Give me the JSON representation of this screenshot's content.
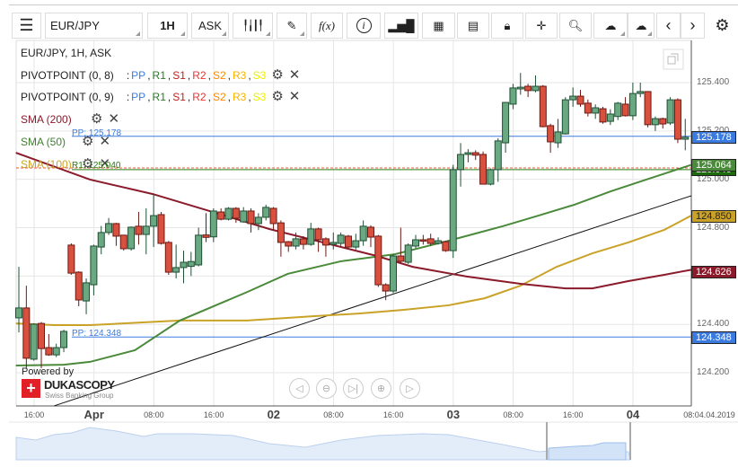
{
  "toolbar": {
    "symbol": "EUR/JPY",
    "timeframe": "1H",
    "side": "ASK",
    "fx_label": "f(x)"
  },
  "legend": {
    "title": "EUR/JPY, 1H, ASK",
    "pivot1": "PIVOTPOINT (0, 8)",
    "pivot2": "PIVOTPOINT (0, 9)",
    "sep": ":",
    "pivot_keys": [
      "PP",
      "R1",
      "S1",
      "R2",
      "S2",
      "R3",
      "S3"
    ],
    "sma200": "SMA (200)",
    "sma50": "SMA (50)",
    "sma100": "SMA (100)"
  },
  "line_labels": {
    "pp_top": "PP: 125.178",
    "r1": "R1: 125.040",
    "pp_bottom": "PP: 124.348"
  },
  "price_tags": {
    "pp_top": "125.178",
    "sma50": "125.064",
    "r1": "125.040",
    "sma100": "124.850",
    "sma200": "124.626",
    "pp_bottom": "124.348"
  },
  "colors": {
    "up": "#6aa882",
    "down": "#d9503f",
    "up_border": "#1f4f33",
    "down_border": "#6b1a14",
    "sma200": "#8b1a2b",
    "sma50": "#4a8a3a",
    "sma100": "#c9a227",
    "pp": "#3b7be0",
    "r1": "#2a7a10",
    "s_dashed": "#e53"
  },
  "branding": {
    "powered": "Powered by",
    "name": "DUKASCOPY",
    "sub": "Swiss Banking Group"
  },
  "chart_data": {
    "type": "candlestick",
    "ylim": [
      124.17,
      125.55
    ],
    "yticks": [
      "125.400",
      "125.200",
      "125.000",
      "124.800",
      "124.600",
      "124.400",
      "124.200"
    ],
    "xticks": [
      "16:00",
      "Apr",
      "08:00",
      "16:00",
      "02",
      "08:00",
      "16:00",
      "03",
      "08:00",
      "16:00",
      "04",
      "08:04.04.2019"
    ],
    "xticks_major": [
      1,
      4,
      7,
      10
    ],
    "candles_ohlc": [
      [
        124.427,
        124.638,
        124.367,
        124.468
      ],
      [
        124.468,
        124.56,
        124.219,
        124.26
      ],
      [
        124.256,
        124.405,
        124.25,
        124.401
      ],
      [
        124.404,
        124.41,
        124.219,
        124.3
      ],
      [
        124.304,
        124.36,
        124.27,
        124.274
      ],
      [
        124.274,
        124.32,
        124.265,
        124.304
      ],
      [
        124.304,
        124.378,
        124.285,
        124.371
      ],
      [
        124.728,
        124.735,
        124.605,
        124.612
      ],
      [
        124.616,
        124.62,
        124.475,
        124.501
      ],
      [
        124.497,
        124.59,
        124.442,
        124.572
      ],
      [
        124.564,
        124.73,
        124.52,
        124.724
      ],
      [
        124.72,
        124.807,
        124.69,
        124.78
      ],
      [
        124.78,
        124.84,
        124.77,
        124.817
      ],
      [
        124.817,
        124.82,
        124.725,
        124.765
      ],
      [
        124.769,
        124.77,
        124.705,
        124.713
      ],
      [
        124.713,
        124.805,
        124.705,
        124.802
      ],
      [
        124.806,
        124.865,
        124.73,
        124.772
      ],
      [
        124.772,
        124.88,
        124.69,
        124.806
      ],
      [
        124.806,
        124.94,
        124.72,
        124.85
      ],
      [
        124.854,
        124.865,
        124.73,
        124.735
      ],
      [
        124.739,
        124.745,
        124.605,
        124.616
      ],
      [
        124.616,
        124.73,
        124.59,
        124.635
      ],
      [
        124.635,
        124.705,
        124.57,
        124.657
      ],
      [
        124.64,
        124.7,
        124.6,
        124.66
      ],
      [
        124.646,
        124.8,
        124.64,
        124.769
      ],
      [
        124.77,
        124.86,
        124.74,
        124.76
      ],
      [
        124.762,
        124.88,
        124.74,
        124.869
      ],
      [
        124.865,
        124.88,
        124.83,
        124.835
      ],
      [
        124.835,
        124.885,
        124.83,
        124.88
      ],
      [
        124.88,
        124.885,
        124.82,
        124.839
      ],
      [
        124.824,
        124.885,
        124.82,
        124.869
      ],
      [
        124.869,
        124.88,
        124.78,
        124.817
      ],
      [
        124.817,
        124.86,
        124.79,
        124.843
      ],
      [
        124.843,
        124.895,
        124.83,
        124.884
      ],
      [
        124.88,
        124.885,
        124.79,
        124.817
      ],
      [
        124.82,
        124.83,
        124.68,
        124.739
      ],
      [
        124.742,
        124.745,
        124.7,
        124.724
      ],
      [
        124.724,
        124.78,
        124.71,
        124.754
      ],
      [
        124.754,
        124.765,
        124.71,
        124.731
      ],
      [
        124.731,
        124.82,
        124.725,
        124.795
      ],
      [
        124.795,
        124.8,
        124.7,
        124.75
      ],
      [
        124.754,
        124.76,
        124.68,
        124.728
      ],
      [
        124.731,
        124.78,
        124.71,
        124.739
      ],
      [
        124.735,
        124.78,
        124.72,
        124.769
      ],
      [
        124.765,
        124.77,
        124.715,
        124.72
      ],
      [
        124.72,
        124.775,
        124.71,
        124.746
      ],
      [
        124.746,
        124.83,
        124.725,
        124.806
      ],
      [
        124.802,
        124.81,
        124.72,
        124.761
      ],
      [
        124.765,
        124.77,
        124.555,
        124.564
      ],
      [
        124.564,
        124.57,
        124.5,
        124.538
      ],
      [
        124.538,
        124.69,
        124.53,
        124.683
      ],
      [
        124.683,
        124.8,
        124.655,
        124.661
      ],
      [
        124.657,
        124.735,
        124.65,
        124.728
      ],
      [
        124.724,
        124.77,
        124.715,
        124.75
      ],
      [
        124.75,
        124.77,
        124.73,
        124.746
      ],
      [
        124.754,
        124.775,
        124.725,
        124.735
      ],
      [
        124.735,
        124.76,
        124.73,
        124.746
      ],
      [
        124.742,
        124.745,
        124.7,
        124.705
      ],
      [
        124.705,
        125.06,
        124.675,
        125.04
      ],
      [
        125.04,
        125.15,
        124.97,
        125.103
      ],
      [
        125.103,
        125.125,
        125.07,
        125.11
      ],
      [
        125.11,
        125.12,
        125.08,
        125.1
      ],
      [
        125.103,
        125.115,
        124.98,
        124.98
      ],
      [
        124.98,
        125.045,
        124.975,
        125.04
      ],
      [
        125.04,
        125.17,
        124.99,
        125.159
      ],
      [
        125.151,
        125.32,
        125.11,
        125.318
      ],
      [
        125.311,
        125.395,
        125.29,
        125.378
      ],
      [
        125.374,
        125.44,
        125.35,
        125.381
      ],
      [
        125.385,
        125.395,
        125.34,
        125.367
      ],
      [
        125.367,
        125.43,
        125.36,
        125.385
      ],
      [
        125.385,
        125.39,
        125.215,
        125.218
      ],
      [
        125.222,
        125.23,
        125.11,
        125.155
      ],
      [
        125.151,
        125.25,
        125.13,
        125.196
      ],
      [
        125.188,
        125.34,
        125.185,
        125.329
      ],
      [
        125.329,
        125.38,
        125.3,
        125.344
      ],
      [
        125.344,
        125.37,
        125.3,
        125.311
      ],
      [
        125.315,
        125.33,
        125.26,
        125.274
      ],
      [
        125.274,
        125.31,
        125.25,
        125.296
      ],
      [
        125.292,
        125.3,
        125.23,
        125.237
      ],
      [
        125.24,
        125.29,
        125.225,
        125.27
      ],
      [
        125.26,
        125.32,
        125.245,
        125.315
      ],
      [
        125.311,
        125.34,
        125.26,
        125.263
      ],
      [
        125.263,
        125.4,
        125.245,
        125.355
      ],
      [
        125.355,
        125.4,
        125.34,
        125.363
      ],
      [
        125.363,
        125.365,
        125.215,
        125.226
      ],
      [
        125.226,
        125.26,
        125.2,
        125.251
      ],
      [
        125.251,
        125.255,
        125.21,
        125.229
      ],
      [
        125.233,
        125.34,
        125.225,
        125.329
      ],
      [
        125.329,
        125.335,
        125.15,
        125.166
      ],
      [
        125.166,
        125.25,
        125.12,
        125.174
      ]
    ],
    "sma200": [
      [
        -0.4,
        125.11
      ],
      [
        9.5,
        124.999
      ],
      [
        17.9,
        124.939
      ],
      [
        26.3,
        124.861
      ],
      [
        33.5,
        124.794
      ],
      [
        40.6,
        124.739
      ],
      [
        47.8,
        124.683
      ],
      [
        52.6,
        124.638
      ],
      [
        59.8,
        124.598
      ],
      [
        67,
        124.568
      ],
      [
        73,
        124.549
      ],
      [
        76.6,
        124.549
      ],
      [
        81.4,
        124.579
      ],
      [
        86.2,
        124.605
      ],
      [
        89.8,
        124.626
      ]
    ],
    "sma50": [
      [
        -0.4,
        124.23
      ],
      [
        6,
        124.233
      ],
      [
        9.5,
        124.245
      ],
      [
        15.5,
        124.293
      ],
      [
        21.5,
        124.416
      ],
      [
        30.5,
        124.534
      ],
      [
        35.9,
        124.609
      ],
      [
        43,
        124.661
      ],
      [
        50.2,
        124.69
      ],
      [
        57.4,
        124.746
      ],
      [
        61,
        124.776
      ],
      [
        64.6,
        124.806
      ],
      [
        69.4,
        124.85
      ],
      [
        74.2,
        124.895
      ],
      [
        79,
        124.95
      ],
      [
        83.8,
        124.999
      ],
      [
        89.8,
        125.06
      ]
    ],
    "sma100": [
      [
        -0.4,
        124.404
      ],
      [
        4.7,
        124.397
      ],
      [
        9.5,
        124.397
      ],
      [
        21.5,
        124.416
      ],
      [
        30.5,
        124.416
      ],
      [
        39.5,
        124.434
      ],
      [
        45.4,
        124.445
      ],
      [
        51.4,
        124.46
      ],
      [
        57.4,
        124.479
      ],
      [
        62.2,
        124.508
      ],
      [
        67,
        124.56
      ],
      [
        71.8,
        124.638
      ],
      [
        76.6,
        124.694
      ],
      [
        81.4,
        124.739
      ],
      [
        86.2,
        124.791
      ],
      [
        89.8,
        124.85
      ]
    ],
    "trendline": [
      [
        4.7,
        124.063
      ],
      [
        89.8,
        124.932
      ]
    ],
    "pp_top": 125.178,
    "r1": 125.04,
    "dashed": 125.047,
    "pp_bottom": 124.348
  }
}
